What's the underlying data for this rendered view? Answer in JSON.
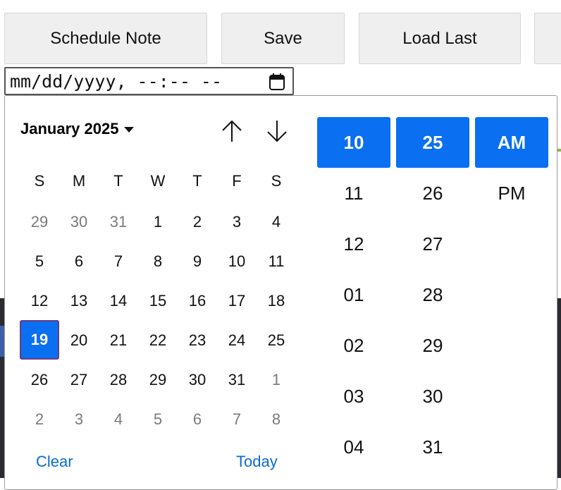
{
  "toolbar": {
    "schedule_label": "Schedule Note",
    "save_label": "Save",
    "load_label": "Load Last",
    "extra_label": ""
  },
  "datetime_input": {
    "value": "mm/dd/yyyy, --:-- --",
    "icon": "calendar-icon"
  },
  "calendar": {
    "month_label": "January 2025",
    "weekdays": [
      "S",
      "M",
      "T",
      "W",
      "T",
      "F",
      "S"
    ],
    "weeks": [
      [
        "29",
        "30",
        "31",
        "1",
        "2",
        "3",
        "4"
      ],
      [
        "5",
        "6",
        "7",
        "8",
        "9",
        "10",
        "11"
      ],
      [
        "12",
        "13",
        "14",
        "15",
        "16",
        "17",
        "18"
      ],
      [
        "19",
        "20",
        "21",
        "22",
        "23",
        "24",
        "25"
      ],
      [
        "26",
        "27",
        "28",
        "29",
        "30",
        "31",
        "1"
      ],
      [
        "2",
        "3",
        "4",
        "5",
        "6",
        "7",
        "8"
      ]
    ],
    "selected_day": "19",
    "clear_label": "Clear",
    "today_label": "Today"
  },
  "time": {
    "hours": [
      "10",
      "11",
      "12",
      "01",
      "02",
      "03",
      "04"
    ],
    "minutes": [
      "25",
      "26",
      "27",
      "28",
      "29",
      "30",
      "31"
    ],
    "meridiem": [
      "AM",
      "PM"
    ],
    "selected_hour": "10",
    "selected_minute": "25",
    "selected_meridiem": "AM"
  },
  "colors": {
    "accent": "#0a6ff0",
    "link": "#0a6ccf",
    "selected_border": "#6b3a82"
  }
}
